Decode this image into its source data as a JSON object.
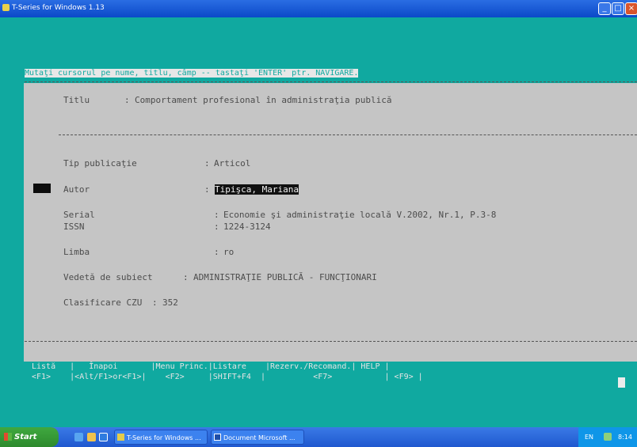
{
  "window": {
    "title": "T-Series for Windows 1.13",
    "buttons": {
      "minimize": "_",
      "maximize": "□",
      "close": "×"
    }
  },
  "prompt": {
    "text": "Mutaţi cursorul pe nume, titlu, câmp -- tastaţi 'ENTER' ptr. NAVIGARE."
  },
  "record": {
    "title_label": "Titlu",
    "title_sep": ":",
    "title_value": "Comportament profesional în administraţia publică",
    "type_label": "Tip publicaţie",
    "type_sep": ":",
    "type_value": "Articol",
    "author_label": "Autor",
    "author_sep": ":",
    "author_value": "Tipişca, Mariana",
    "serial_label": "Serial",
    "serial_sep": ":",
    "serial_value": "Economie şi administraţie locală V.2002, Nr.1, P.3-8",
    "issn_label": "ISSN",
    "issn_sep": ":",
    "issn_value": "1224-3124",
    "language_label": "Limba",
    "language_sep": ":",
    "language_value": "ro",
    "subject_label": "Vedetă de subiect",
    "subject_sep": ":",
    "subject_value": "ADMINISTRAŢIE PUBLICĂ - FUNCŢIONARI",
    "class_label": "Clasificare CZU",
    "class_sep": ":",
    "class_value": "352"
  },
  "help": {
    "line1": "Listă   |   Înapoi       |Menu Princ.|Listare    |Rezerv./Recomand.| HELP |",
    "line2": "<F1>    |<Alt/F1>or<F1>|    <F2>     |SHIFT+F4  |          <F7>           | <F9> |"
  },
  "taskbar": {
    "start_label": "Start",
    "tasks": [
      "T-Series for Windows ...",
      "Document Microsoft ..."
    ],
    "tray_lang": "EN",
    "tray_time": "8:14"
  }
}
